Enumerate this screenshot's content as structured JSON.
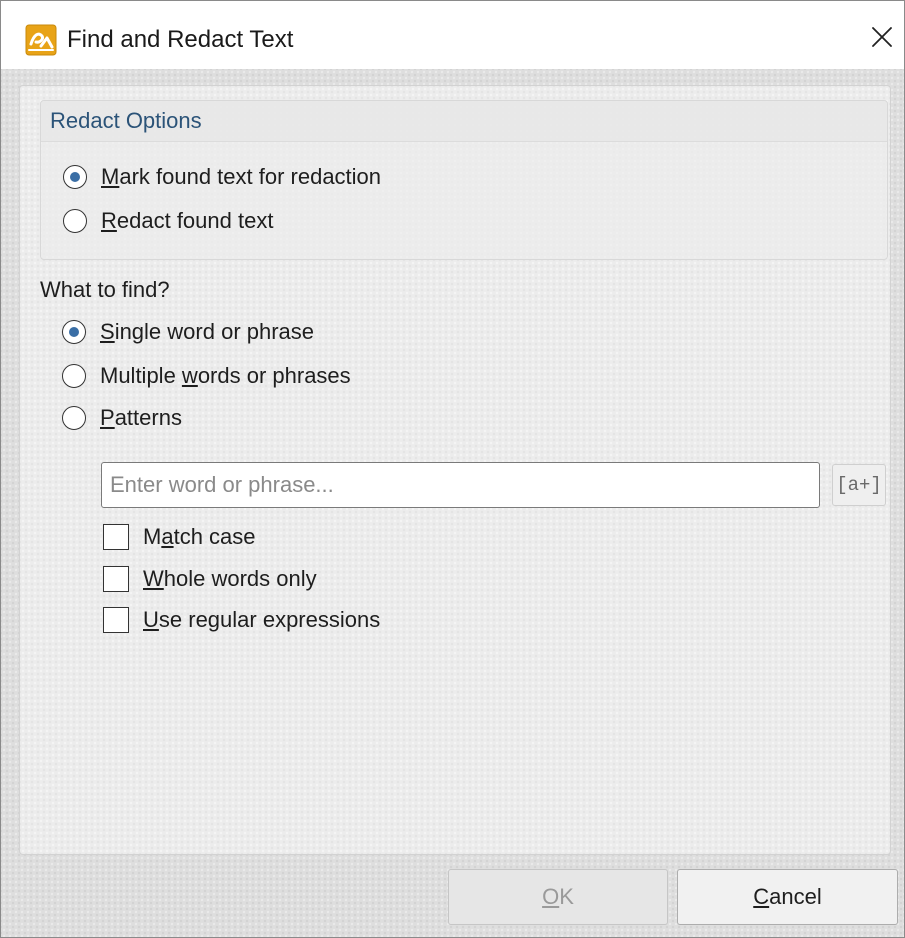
{
  "window": {
    "title": "Find and Redact Text",
    "app_icon": "pdf-app-icon",
    "close_icon": "close-icon"
  },
  "redact_options": {
    "title": "Redact Options",
    "options": [
      {
        "label": "Mark found text for redaction",
        "mnemonic": "M",
        "selected": true
      },
      {
        "label": "Redact found text",
        "mnemonic": "R",
        "selected": false
      }
    ]
  },
  "find": {
    "title": "What to find?",
    "options": [
      {
        "label": "Single word or phrase",
        "mnemonic": "S",
        "selected": true
      },
      {
        "label": "Multiple words or phrases",
        "mnemonic": "w",
        "selected": false
      },
      {
        "label": "Patterns",
        "mnemonic": "P",
        "selected": false
      }
    ],
    "input": {
      "value": "",
      "placeholder": "Enter word or phrase..."
    },
    "regex_button": "[a+]",
    "checkboxes": [
      {
        "label": "Match case",
        "mnemonic": "a",
        "checked": false
      },
      {
        "label": "Whole words only",
        "mnemonic": "W",
        "checked": false
      },
      {
        "label": "Use regular expressions",
        "mnemonic": "U",
        "checked": false
      }
    ]
  },
  "buttons": {
    "ok": "OK",
    "ok_enabled": false,
    "cancel": "Cancel"
  },
  "colors": {
    "group_title": "#2b5378",
    "radio_dot": "#3a6ea5",
    "app_icon": "#e8a317"
  }
}
